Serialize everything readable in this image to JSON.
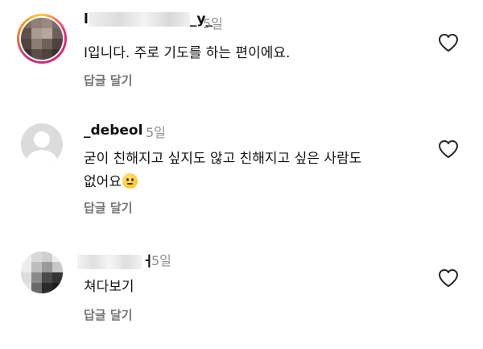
{
  "comments": [
    {
      "username_visible_start": "l",
      "username_visible_end": "_y_",
      "time": "5일",
      "text": "I입니다. 주로 기도를 하는 편이에요.",
      "reply_label": "답글 달기"
    },
    {
      "username": "_debeol",
      "time": "5일",
      "text_line1": "굳이 친해지고 싶지도 않고 친해지고 싶은 사람도",
      "text_line2": "없어요",
      "reply_label": "답글 달기"
    },
    {
      "username_visible_end": "ㅓ",
      "time": "5일",
      "text": "쳐다보기",
      "reply_label": "답글 달기"
    }
  ],
  "icons": {
    "like": "heart-outline-icon",
    "emoji": "neutral-face-emoji"
  },
  "colors": {
    "text": "#111111",
    "secondary": "#8e8e8e",
    "reply": "#737373",
    "story_ring": "#ee2a7b"
  }
}
